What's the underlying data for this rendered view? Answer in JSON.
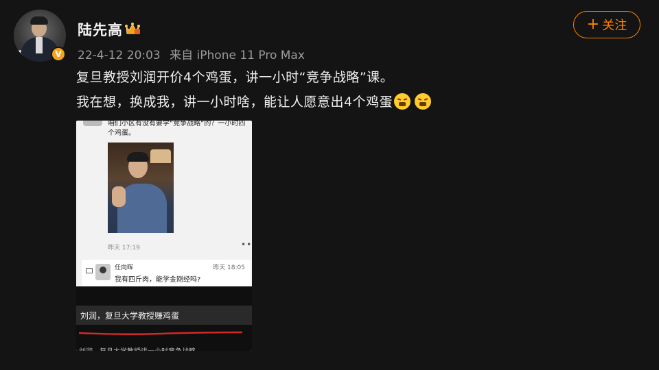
{
  "post": {
    "username": "陆先高",
    "verified_badge": "V",
    "meta": {
      "date": "22-4-12 20:03",
      "source": "来自 iPhone 11 Pro Max"
    },
    "follow_label": "关注",
    "follow_icon": "plus-icon",
    "text_line1": "复旦教授刘润开价4个鸡蛋，讲一小时“竞争战略”课。",
    "text_line2": "我在想，换成我，讲一小时啥，能让人愿意出4个鸡蛋",
    "emojis": [
      "steaming-face-emoji",
      "steaming-face-emoji"
    ]
  },
  "image": {
    "top_chat_text": "咱们小区有没有要学“竞争战略”的？一小时四个鸡蛋。",
    "time1": "昨天 17:19",
    "dots": "••",
    "comment": {
      "name": "任向晖",
      "time": "昨天 18:05",
      "text": "我有四斤肉，能学金刚经吗?"
    },
    "caption": "刘润，复旦大学教授赚鸡蛋",
    "bottom_text": "刘润，复旦大学教授讲一小时竞争战略"
  },
  "colors": {
    "background": "#141414",
    "accent": "#ff8200",
    "verified": "#f7a21d"
  }
}
